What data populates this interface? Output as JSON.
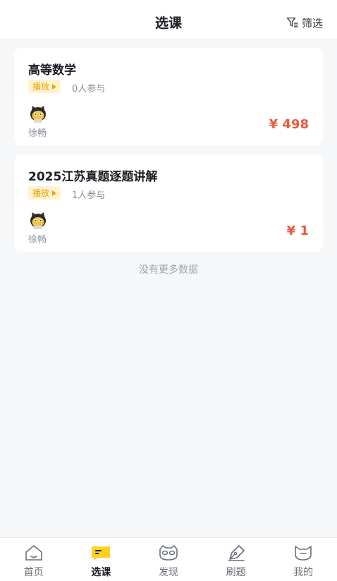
{
  "header": {
    "title": "选课",
    "filter_label": "筛选"
  },
  "courses": [
    {
      "title": "高等数学",
      "badge": "播放",
      "participants": "0人参与",
      "teacher": "徐畅",
      "price": "¥ 498"
    },
    {
      "title": "2025江苏真题逐题讲解",
      "badge": "播放",
      "participants": "1人参与",
      "teacher": "徐畅",
      "price": "¥ 1"
    }
  ],
  "no_more": "没有更多数据",
  "tabs": [
    {
      "label": "首页",
      "icon": "home-icon"
    },
    {
      "label": "选课",
      "icon": "course-icon",
      "active": true
    },
    {
      "label": "发现",
      "icon": "discover-icon"
    },
    {
      "label": "刷题",
      "icon": "practice-icon"
    },
    {
      "label": "我的",
      "icon": "profile-icon"
    }
  ],
  "colors": {
    "accent_yellow": "#ffd21f",
    "price_red": "#e95a3d",
    "badge_bg": "#fff3cf",
    "badge_text": "#e8a50a"
  }
}
